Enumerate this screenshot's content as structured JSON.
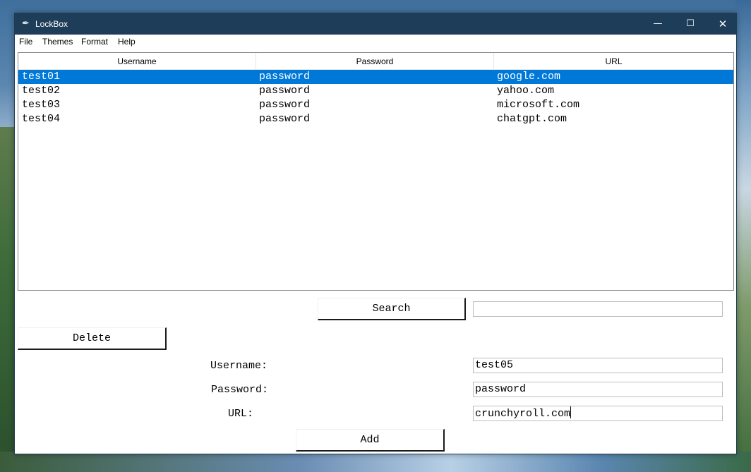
{
  "window": {
    "title": "LockBox",
    "app_icon": "feather-icon",
    "controls": {
      "minimize": "—",
      "maximize": "☐",
      "close": "✕"
    }
  },
  "menu": [
    "File",
    "Themes",
    "Format",
    "Help"
  ],
  "table": {
    "columns": [
      "Username",
      "Password",
      "URL"
    ],
    "rows": [
      {
        "username": "test01",
        "password": "password",
        "url": "google.com",
        "selected": true
      },
      {
        "username": "test02",
        "password": "password",
        "url": "yahoo.com",
        "selected": false
      },
      {
        "username": "test03",
        "password": "password",
        "url": "microsoft.com",
        "selected": false
      },
      {
        "username": "test04",
        "password": "password",
        "url": "chatgpt.com",
        "selected": false
      }
    ]
  },
  "search": {
    "button_label": "Search",
    "value": ""
  },
  "delete": {
    "button_label": "Delete"
  },
  "form": {
    "username_label": "Username:",
    "username_value": "test05",
    "password_label": "Password:",
    "password_value": "password",
    "url_label": "URL:",
    "url_value": "crunchyroll.com",
    "add_label": "Add"
  },
  "colors": {
    "titlebar": "#1d3d58",
    "selection": "#0078d7"
  }
}
